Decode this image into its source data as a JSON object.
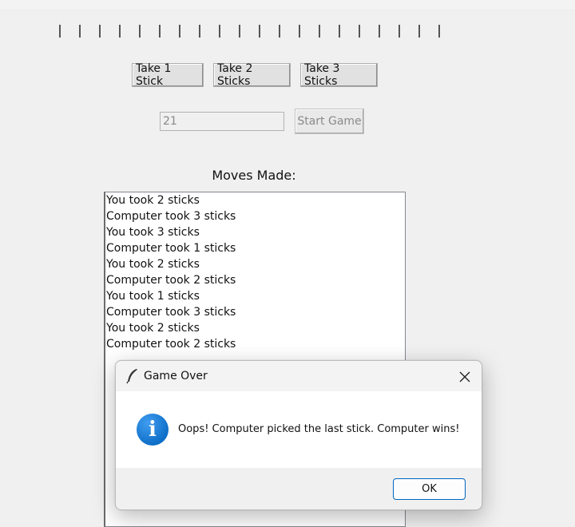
{
  "sticks": {
    "count": 20
  },
  "buttons": {
    "take1": "Take 1 Stick",
    "take2": "Take 2 Sticks",
    "take3": "Take 3 Sticks",
    "start": "Start Game"
  },
  "entry": {
    "value": "21"
  },
  "moves": {
    "label": "Moves Made:",
    "items": [
      "You took 2 sticks",
      "Computer took 3 sticks",
      "You took 3 sticks",
      "Computer took 1 sticks",
      "You took 2 sticks",
      "Computer took 2 sticks",
      "You took 1 sticks",
      "Computer took 3 sticks",
      "You took 2 sticks",
      "Computer took 2 sticks"
    ]
  },
  "dialog": {
    "title": "Game Over",
    "message": "Oops! Computer picked the last stick. Computer wins!",
    "ok": "OK",
    "icon": "info-icon",
    "app_icon": "feather-icon",
    "close_icon": "close-icon"
  },
  "colors": {
    "accent": "#0067c0",
    "info": "#1a7fd8"
  }
}
